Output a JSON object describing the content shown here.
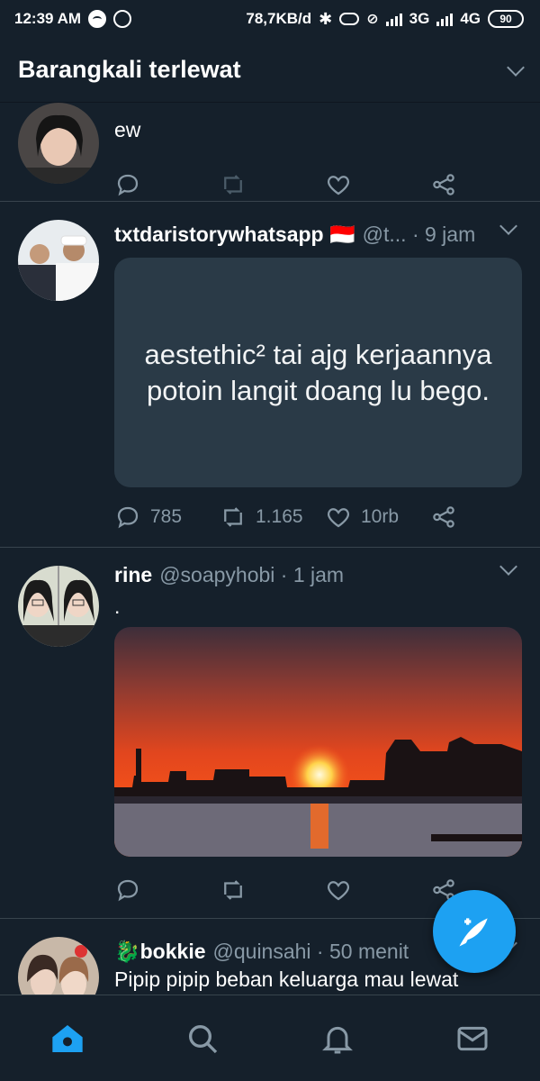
{
  "status_bar": {
    "time": "12:39 AM",
    "speed": "78,7KB/d",
    "net1": "3G",
    "net2": "4G",
    "battery": "90",
    "icons": [
      "spotify-icon",
      "whatsapp-icon",
      "bluetooth-icon",
      "vibrate-icon",
      "mute-icon",
      "signal-icon",
      "battery-icon"
    ]
  },
  "header": {
    "title": "Barangkali terlewat"
  },
  "tweets": [
    {
      "text": "ew",
      "actions": {
        "reply": "",
        "retweet": "",
        "like": ""
      }
    },
    {
      "name": "txtdaristorywhatsapp 🇮🇩",
      "handle": "@t... · 9 jam",
      "card_text": "aestethic² tai ajg kerjaannya potoin langit doang lu bego.",
      "actions": {
        "reply": "785",
        "retweet": "1.165",
        "like": "10rb"
      }
    },
    {
      "name": "rine",
      "handle": "@soapyhobi · 1 jam",
      "text": ".",
      "actions": {
        "reply": "",
        "retweet": "",
        "like": ""
      }
    },
    {
      "name": "🐉bokkie",
      "handle": "@quinsahi · 50 menit",
      "text": "Pipip pipip beban keluarga mau lewat"
    }
  ],
  "fab": {
    "icon": "compose-tweet-icon"
  },
  "bottom_nav": [
    "home-icon",
    "search-icon",
    "notifications-icon",
    "messages-icon"
  ],
  "colors": {
    "background": "#15202b",
    "accent": "#1da1f2",
    "muted": "#8899a6",
    "divider": "#38444d",
    "card": "#2a3a47"
  }
}
